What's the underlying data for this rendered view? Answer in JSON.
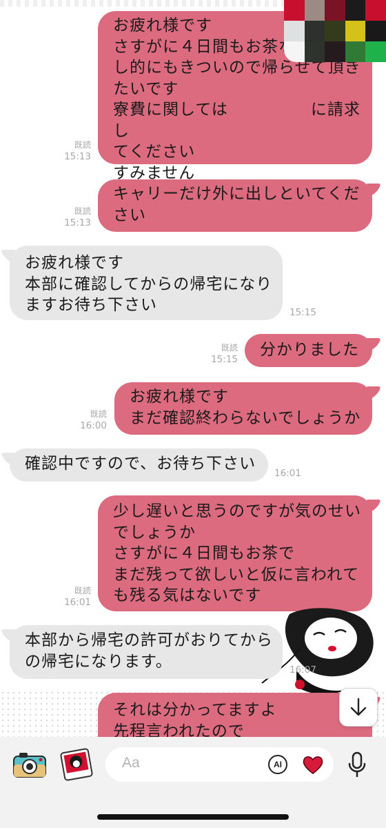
{
  "messages": [
    {
      "dir": "out",
      "text": "お疲れ様です\nさすがに４日間もお茶なので\nし的にもきついので帰らせて頂き\nたいです\n寮費に関しては　　　　　に請求し\nてください\nすみません",
      "read": "既読",
      "time": "15:13"
    },
    {
      "dir": "out",
      "text": "キャリーだけ外に出しといてくだ\nさい",
      "read": "既読",
      "time": "15:13"
    },
    {
      "dir": "in",
      "text": "お疲れ様です\n本部に確認してからの帰宅になり\nますお待ち下さい",
      "time": "15:15"
    },
    {
      "dir": "out",
      "text": "分かりました",
      "read": "既読",
      "time": "15:15"
    },
    {
      "dir": "out",
      "text": "お疲れ様です\nまだ確認終わらないでしょうか",
      "read": "既読",
      "time": "16:00"
    },
    {
      "dir": "in",
      "text": "確認中ですので、お待ち下さい",
      "time": "16:01"
    },
    {
      "dir": "out",
      "text": "少し遅いと思うのですが気のせい\nでしょうか\nさすがに４日間もお茶で\nまだ残って欲しいと仮に言われて\nも残る気はないです",
      "read": "既読",
      "time": "16:01"
    },
    {
      "dir": "in",
      "text": "本部から帰宅の許可がおりてから\nの帰宅になります。",
      "time": "16:07"
    },
    {
      "dir": "out",
      "text": "それは分かってますよ\n先程言われたので",
      "read": "",
      "time": ""
    }
  ],
  "composer": {
    "placeholder": "Aa",
    "ai_label": "AI"
  },
  "icons": {
    "camera": "camera-icon",
    "sticker": "sticker-icon",
    "heart": "heart-icon",
    "mic": "microphone-icon",
    "scroll": "arrow-down-icon"
  },
  "colors": {
    "outgoing_bubble": "#dd6b80",
    "incoming_bubble": "#e7e7e7",
    "heart": "#d81b3a"
  }
}
